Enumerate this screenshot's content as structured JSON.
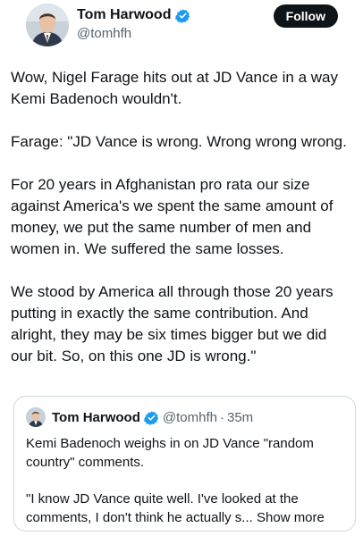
{
  "author": {
    "display_name": "Tom Harwood",
    "handle": "@tomhfh"
  },
  "follow_label": "Follow",
  "paragraphs": [
    "Wow, Nigel Farage hits out at JD Vance in a way Kemi Badenoch wouldn't.",
    "Farage: \"JD Vance is wrong. Wrong wrong wrong.",
    "For 20 years in Afghanistan pro rata our size against America's we spent the same amount of money, we put the same number of men and women in. We suffered the same losses.",
    "We stood by America all through those 20 years putting in exactly the same contribution. And alright, they may be six times bigger but we did our bit. So, on this one JD is wrong.\""
  ],
  "quote": {
    "display_name": "Tom Harwood",
    "handle": "@tomhfh",
    "separator": "·",
    "time": "35m",
    "paragraphs": [
      "Kemi Badenoch weighs in on JD Vance \"random country\" comments.",
      "\"I know JD Vance quite well. I've looked at the comments, I don't think he actually s..."
    ],
    "show_more_label": "Show more"
  },
  "colors": {
    "verified": "#1d9bf0",
    "text": "#0f1419",
    "secondary": "#536471",
    "border": "#cfd9de"
  },
  "icons": {
    "verified": "verified-badge-icon"
  }
}
